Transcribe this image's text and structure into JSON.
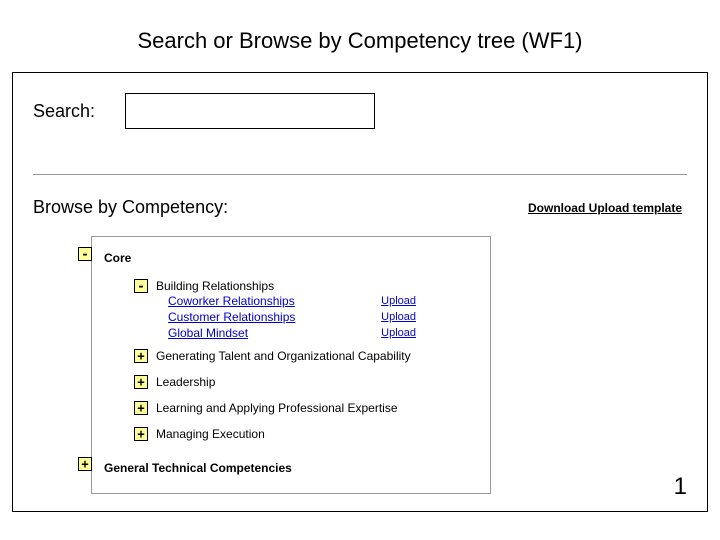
{
  "title": "Search or Browse by Competency tree (WF1)",
  "search": {
    "label": "Search:",
    "value": "",
    "placeholder": ""
  },
  "browse": {
    "label": "Browse by Competency:",
    "download_link": "Download Upload template"
  },
  "tree": {
    "core": {
      "toggle": "-",
      "label": "Core",
      "children": {
        "building": {
          "toggle": "-",
          "label": "Building Relationships",
          "leaves": [
            {
              "label": "Coworker Relationships",
              "action": "Upload"
            },
            {
              "label": "Customer Relationships",
              "action": "Upload"
            },
            {
              "label": "Global Mindset",
              "action": "Upload"
            }
          ]
        },
        "gentalent": {
          "toggle": "+",
          "label": "Generating Talent and Organizational Capability"
        },
        "leadership": {
          "toggle": "+",
          "label": "Leadership"
        },
        "learning": {
          "toggle": "+",
          "label": "Learning and Applying Professional Expertise"
        },
        "managing": {
          "toggle": "+",
          "label": "Managing Execution"
        }
      }
    },
    "gentech": {
      "toggle": "+",
      "label": "General Technical Competencies"
    }
  },
  "page_number": "1"
}
